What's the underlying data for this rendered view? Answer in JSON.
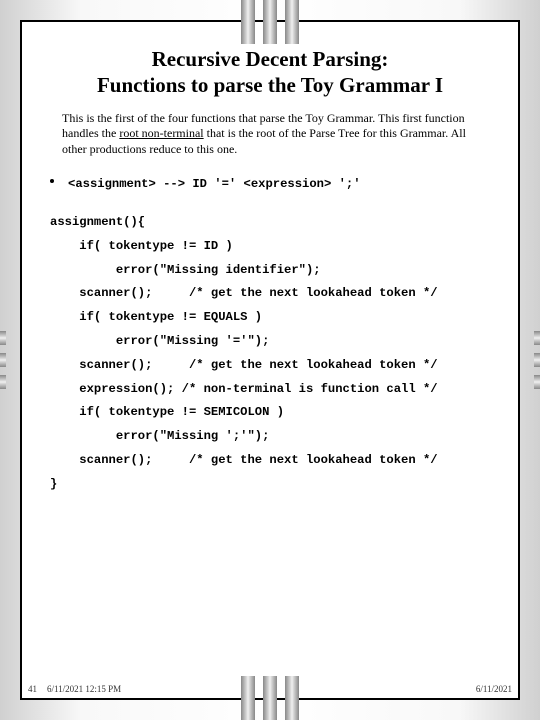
{
  "title_line1": "Recursive Decent Parsing:",
  "title_line2": "Functions to parse the Toy Grammar I",
  "intro_pre": "This is the first of the four functions that parse the Toy Grammar.  This first function handles the ",
  "intro_underlined": "root non-terminal",
  "intro_post": " that is the root of the Parse Tree for this Grammar.  All other productions reduce to this one.",
  "grammar_rule": "<assignment> --> ID '=' <expression> ';'",
  "code": "assignment(){\n    if( tokentype != ID )\n         error(\"Missing identifier\");\n    scanner();     /* get the next lookahead token */\n    if( tokentype != EQUALS )\n         error(\"Missing '='\");\n    scanner();     /* get the next lookahead token */\n    expression(); /* non-terminal is function call */\n    if( tokentype != SEMICOLON )\n         error(\"Missing ';'\");\n    scanner();     /* get the next lookahead token */\n}",
  "footer": {
    "page": "41",
    "timestamp": "6/11/2021 12:15 PM",
    "date_right": "6/11/2021"
  }
}
